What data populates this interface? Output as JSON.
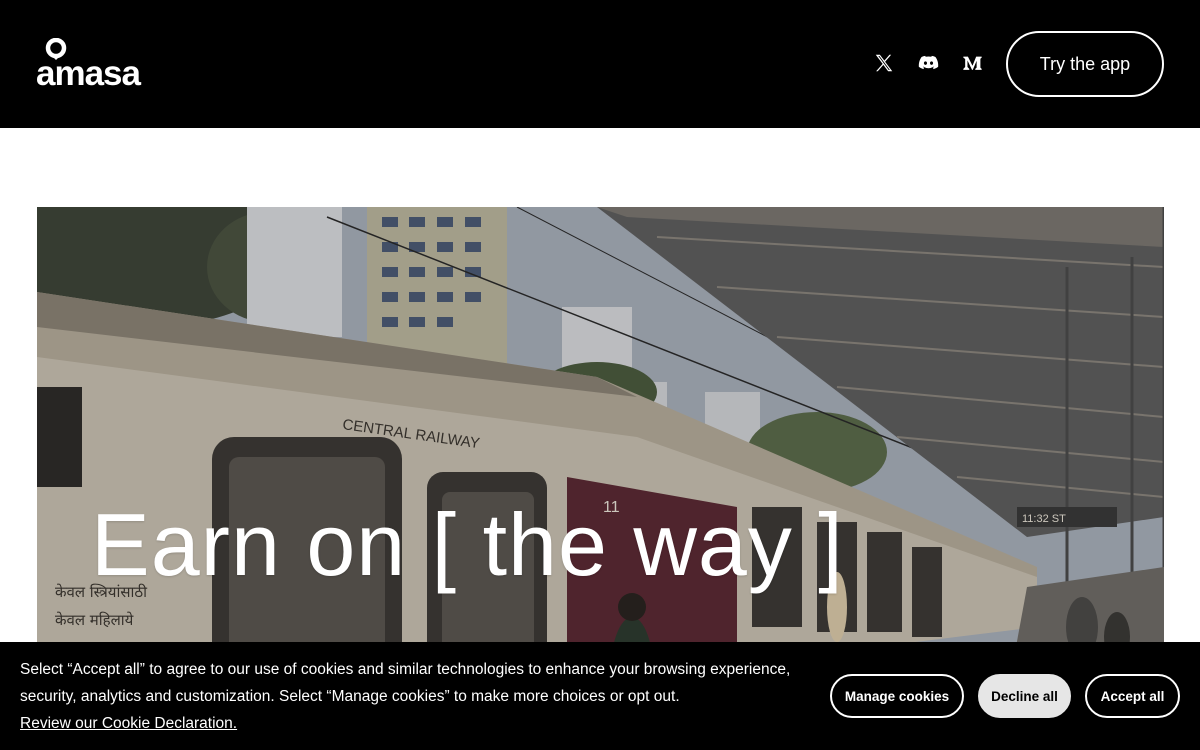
{
  "header": {
    "logo_text": "amasa",
    "social": [
      {
        "icon": "x-twitter-icon"
      },
      {
        "icon": "discord-icon"
      },
      {
        "icon": "medium-icon"
      }
    ],
    "cta_label": "Try the app"
  },
  "hero": {
    "title": "Earn on [ the way ]",
    "image_labels": {
      "coach_text": "CENTRAL RAILWAY",
      "window_sign_1": "केवल स्त्रियांसाठी",
      "window_sign_2": "केवल महिलाये",
      "coach_number": "11",
      "platform_clock": "11:32 ST"
    }
  },
  "cookie_banner": {
    "message": "Select “Accept all” to agree to our use of cookies and similar technologies to enhance your browsing experience, security, analytics and customization. Select “Manage cookies” to make more choices or opt out.",
    "link_label": "Review our Cookie Declaration.",
    "manage_label": "Manage cookies",
    "decline_label": "Decline all",
    "accept_label": "Accept all"
  },
  "colors": {
    "header_bg": "#000000",
    "banner_bg": "#000000",
    "decline_bg": "#e6e6e6",
    "text_light": "#ffffff"
  }
}
